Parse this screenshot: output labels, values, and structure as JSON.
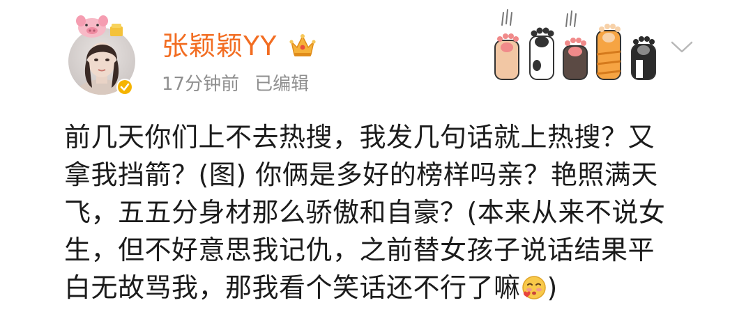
{
  "post": {
    "author_name": "张颖颖YY",
    "time_ago": "17分钟前",
    "edited_label": "已编辑",
    "lines": [
      "前几天你们上不去热搜，我发几句话就上热搜？又",
      "拿我挡箭？(图) 你俩是多好的榜样吗亲？艳照满天",
      "飞，五五分身材那么骄傲和自豪？(本来从来不说女",
      "生，但不好意思我记仇，之前替女孩子说话结果平",
      "白无故骂我，那我看个笑话还不行了嘛",
      ")"
    ]
  },
  "icons": {
    "avatar": "avatar",
    "avatar_decoration": "pig-ears-icon",
    "verified": "verified-badge-icon",
    "crown": "crown-icon",
    "paws": "cat-paws-icon",
    "more": "chevron-down-icon",
    "emoji": "blushing-emoji-icon"
  },
  "colors": {
    "author_name": "#f26d22",
    "meta_text": "#8f8f8f",
    "body_text": "#1b1b1b",
    "verified_badge": "#f5b400"
  }
}
